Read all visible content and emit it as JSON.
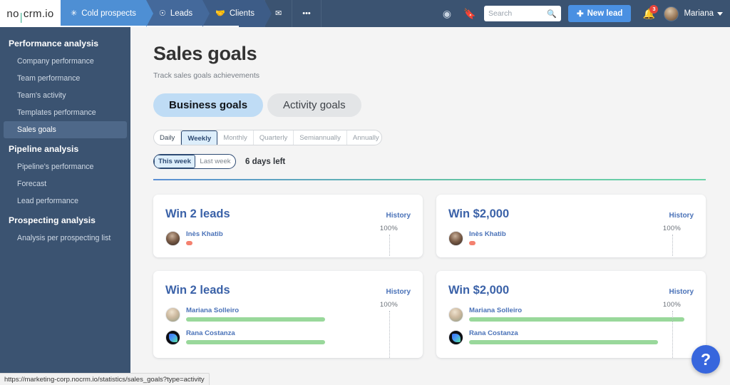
{
  "topnav": {
    "logo": {
      "part1": "no",
      "divider": "|",
      "part2": "crm",
      "part3": ".io"
    },
    "tabs": [
      {
        "label": "Cold prospects",
        "icon": "snowflake-icon",
        "glyph": "✳"
      },
      {
        "label": "Leads",
        "icon": "target-icon",
        "glyph": "☉"
      },
      {
        "label": "Clients",
        "icon": "handshake-icon",
        "glyph": "🤝"
      },
      {
        "label": "",
        "icon": "envelope-icon",
        "glyph": "✉"
      },
      {
        "label": "",
        "icon": "ellipsis-icon",
        "glyph": "•••"
      }
    ],
    "goal_icon": "goal-target-icon",
    "bookmark_icon": "bookmark-icon",
    "search": {
      "value": "",
      "placeholder": "Search",
      "icon": "magnifier-icon"
    },
    "new_lead_label": "New lead",
    "notification_count": "3",
    "username": "Mariana"
  },
  "sidebar": {
    "groups": [
      {
        "title": "Performance analysis",
        "items": [
          {
            "label": "Company performance",
            "selected": false
          },
          {
            "label": "Team performance",
            "selected": false
          },
          {
            "label": "Team's activity",
            "selected": false
          },
          {
            "label": "Templates performance",
            "selected": false
          },
          {
            "label": "Sales goals",
            "selected": true
          }
        ]
      },
      {
        "title": "Pipeline analysis",
        "items": [
          {
            "label": "Pipeline's performance",
            "selected": false
          },
          {
            "label": "Forecast",
            "selected": false
          },
          {
            "label": "Lead performance",
            "selected": false
          }
        ]
      },
      {
        "title": "Prospecting analysis",
        "items": [
          {
            "label": "Analysis per prospecting list",
            "selected": false
          }
        ]
      }
    ]
  },
  "main": {
    "title": "Sales goals",
    "subtitle": "Track sales goals achievements",
    "goal_tabs": [
      {
        "label": "Business goals",
        "active": true
      },
      {
        "label": "Activity goals",
        "active": false
      }
    ],
    "periods": [
      {
        "label": "Daily",
        "state": "dark"
      },
      {
        "label": "Weekly",
        "state": "selected"
      },
      {
        "label": "Monthly",
        "state": "normal"
      },
      {
        "label": "Quarterly",
        "state": "normal"
      },
      {
        "label": "Semiannually",
        "state": "normal"
      },
      {
        "label": "Annually",
        "state": "normal"
      }
    ],
    "week_toggle": [
      {
        "label": "This week",
        "selected": true
      },
      {
        "label": "Last week",
        "selected": false
      }
    ],
    "days_left": "6 days left",
    "cards": [
      {
        "title": "Win 2 leads",
        "history_label": "History",
        "pct_label": "100%",
        "people": [
          {
            "name": "Inès Khatib",
            "avatar": "ines",
            "progress_pct": 3,
            "bar_color": "#f4816f"
          }
        ]
      },
      {
        "title": "Win $2,000",
        "history_label": "History",
        "pct_label": "100%",
        "people": [
          {
            "name": "Inès Khatib",
            "avatar": "ines",
            "progress_pct": 3,
            "bar_color": "#f4816f"
          }
        ]
      },
      {
        "title": "Win 2 leads",
        "history_label": "History",
        "pct_label": "100%",
        "people": [
          {
            "name": "Mariana Solleiro",
            "avatar": "mariana",
            "progress_pct": 82,
            "bar_color": "#99d89b"
          },
          {
            "name": "Rana Costanza",
            "avatar": "rana",
            "progress_pct": 82,
            "bar_color": "#99d89b"
          }
        ]
      },
      {
        "title": "Win $2,000",
        "history_label": "History",
        "pct_label": "100%",
        "people": [
          {
            "name": "Mariana Solleiro",
            "avatar": "mariana",
            "progress_pct": 112,
            "bar_color": "#99d89b"
          },
          {
            "name": "Rana Costanza",
            "avatar": "rana",
            "progress_pct": 100,
            "bar_color": "#99d89b"
          }
        ]
      }
    ]
  },
  "help_button_label": "?",
  "status_url": "https://marketing-corp.nocrm.io/statistics/sales_goals?type=activity"
}
